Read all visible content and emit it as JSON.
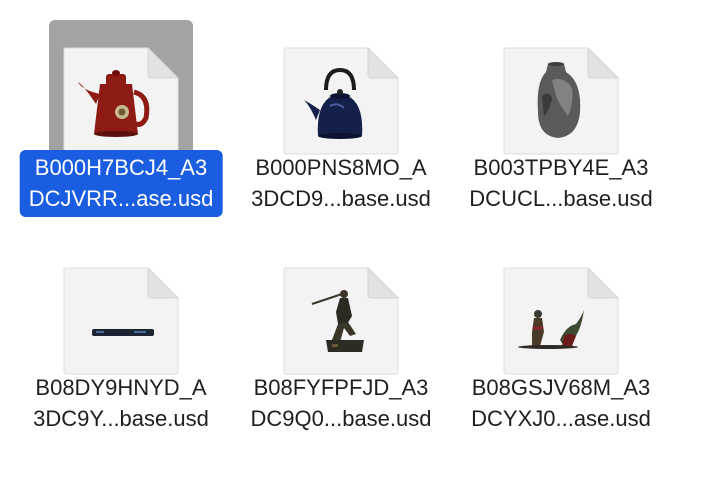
{
  "files": [
    {
      "line1": "B000H7BCJ4_A3",
      "line2": "DCJVRR...ase.usd",
      "selected": true,
      "thumbnail": "red-coffee-pot"
    },
    {
      "line1": "B000PNS8MO_A",
      "line2": "3DCD9...base.usd",
      "selected": false,
      "thumbnail": "navy-kettle"
    },
    {
      "line1": "B003TPBY4E_A3",
      "line2": "DCUCL...base.usd",
      "selected": false,
      "thumbnail": "grey-vase"
    },
    {
      "line1": "B08DY9HNYD_A",
      "line2": "3DC9Y...base.usd",
      "selected": false,
      "thumbnail": "dark-bar"
    },
    {
      "line1": "B08FYFPFJD_A3",
      "line2": "DC9Q0...base.usd",
      "selected": false,
      "thumbnail": "warrior-figurine"
    },
    {
      "line1": "B08GSJV68M_A3",
      "line2": "DCYXJ0...ase.usd",
      "selected": false,
      "thumbnail": "two-figurines"
    }
  ],
  "colors": {
    "selection_thumb_bg": "#a3a3a3",
    "selection_label_bg": "#1a5de0",
    "label_text": "#1f1f1f"
  }
}
